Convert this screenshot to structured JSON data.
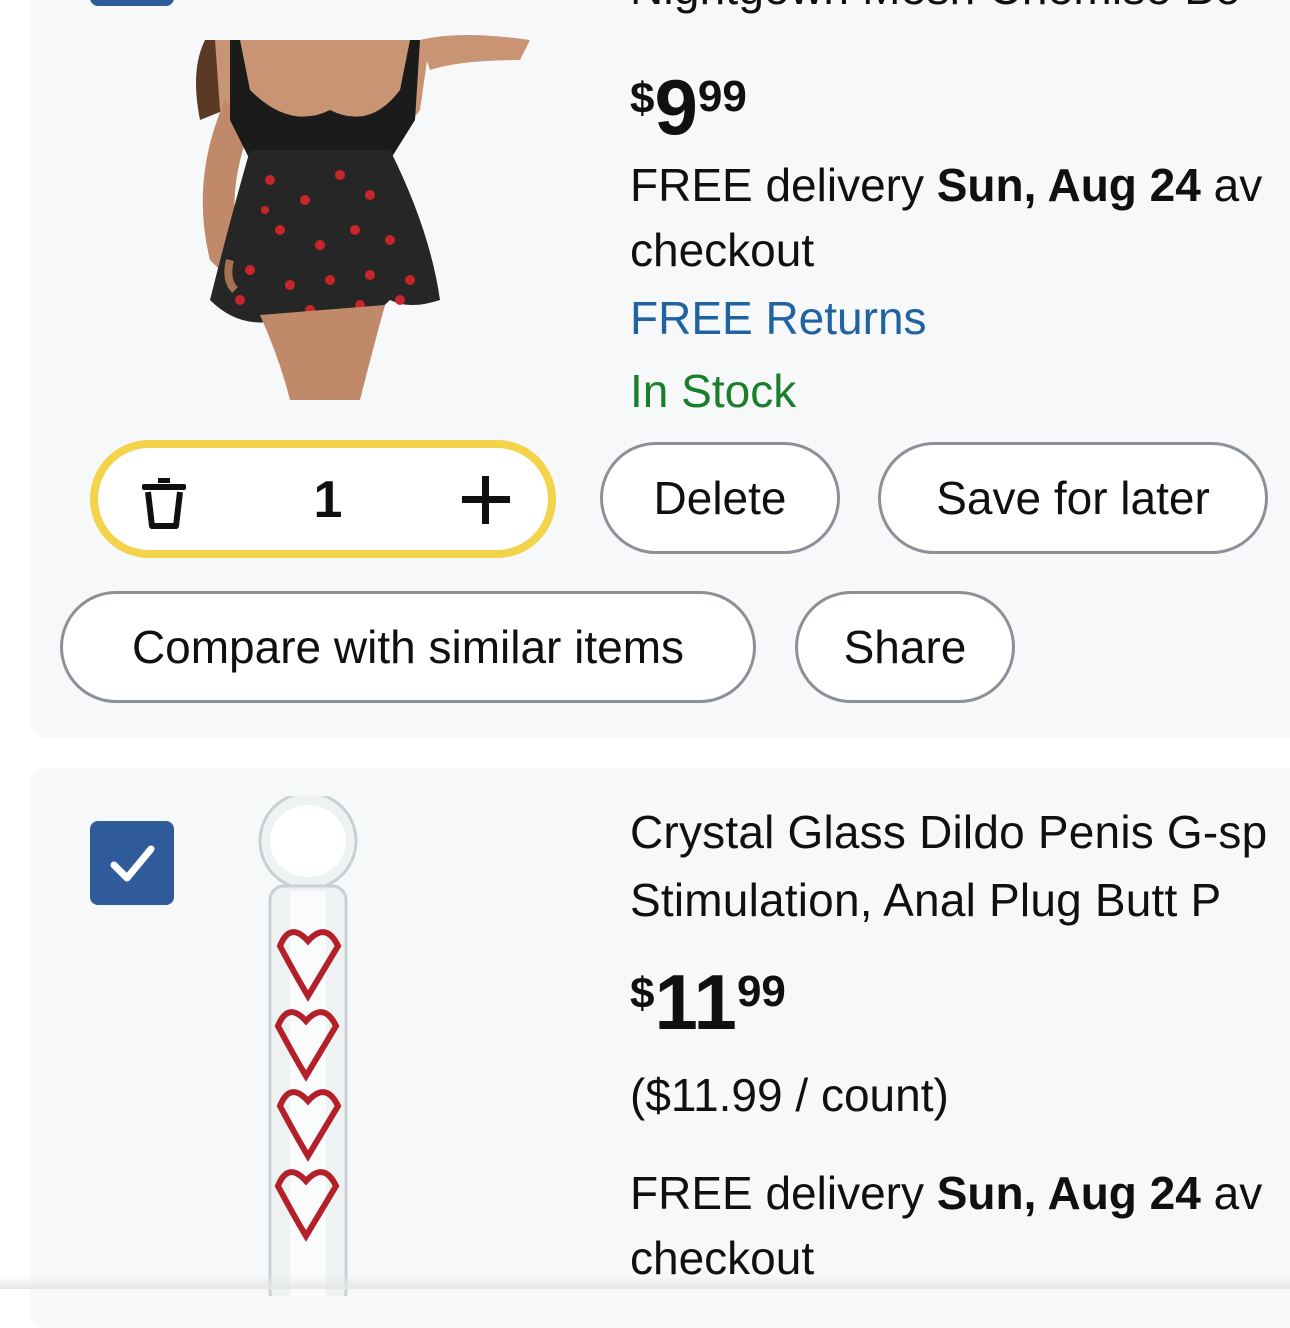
{
  "items": [
    {
      "title_partial": "Nightgown Mesh Chemise Bo",
      "price": {
        "currency": "$",
        "whole": "9",
        "fraction": "99"
      },
      "delivery": {
        "prefix": "FREE delivery ",
        "date": "Sun, Aug 24",
        "suffix": " av",
        "line2": "checkout"
      },
      "returns": "FREE Returns",
      "stock": "In Stock",
      "quantity": "1",
      "buttons": {
        "delete": "Delete",
        "save": "Save for later",
        "compare": "Compare with similar items",
        "share": "Share"
      }
    },
    {
      "checked": true,
      "title_line1": "Crystal Glass Dildo Penis G-sp",
      "title_line2": "Stimulation, Anal Plug Butt P",
      "price": {
        "currency": "$",
        "whole": "11",
        "fraction": "99"
      },
      "unit_price": "($11.99 / count)",
      "delivery": {
        "prefix": "FREE delivery ",
        "date": "Sun, Aug 24",
        "suffix": " av",
        "line2": "checkout"
      }
    }
  ],
  "colors": {
    "accent_checkbox": "#2f5b9b",
    "link": "#2162a1",
    "in_stock": "#1a7f2a",
    "qty_border": "#f3d34a"
  }
}
